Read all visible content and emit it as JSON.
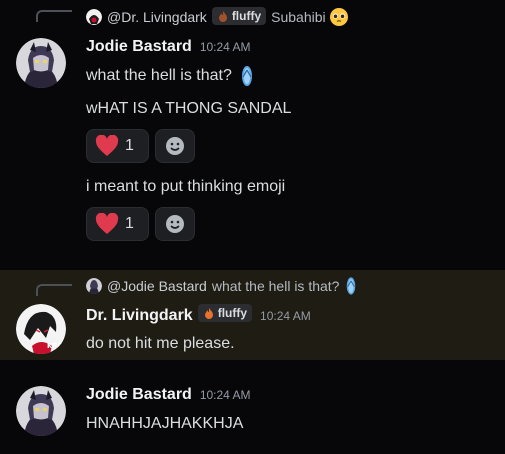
{
  "messages": [
    {
      "reply": {
        "name": "@Dr. Livingdark",
        "tag": "fluffy",
        "text": "Subahibi"
      },
      "author": "Jodie Bastard",
      "time": "10:24 AM",
      "lines": [
        "what the hell is that?",
        "wHAT IS A THONG SANDAL"
      ],
      "reaction1": {
        "emoji": "heart-icon",
        "count": "1"
      },
      "line3": "i meant to put thinking emoji",
      "reaction2": {
        "emoji": "heart-icon",
        "count": "1"
      }
    },
    {
      "reply": {
        "name": "@Jodie Bastard",
        "text": "what the hell is that?"
      },
      "author": "Dr. Livingdark",
      "tag": "fluffy",
      "time": "10:24 AM",
      "lines": [
        "do not hit me please."
      ]
    },
    {
      "author": "Jodie Bastard",
      "time": "10:24 AM",
      "lines": [
        "HNAHHJAJHAKKHJA"
      ]
    }
  ],
  "colors": {
    "highlight": "#1f1c14",
    "heart": "#e03a4e",
    "background": "#070709"
  }
}
